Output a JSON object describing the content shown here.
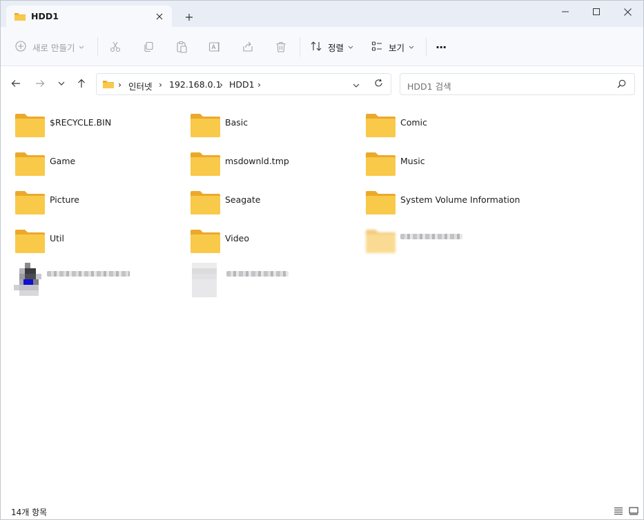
{
  "tab": {
    "title": "HDD1",
    "close_icon": "close-icon",
    "new_tab_icon": "plus-icon"
  },
  "window_controls": {
    "minimize": "minimize-icon",
    "maximize": "maximize-icon",
    "close": "close-icon"
  },
  "toolbar": {
    "new_label": "새로 만들기",
    "sort_label": "정렬",
    "view_label": "보기",
    "more_label": "···"
  },
  "address": {
    "crumbs": [
      "인터넷",
      "192.168.0.1",
      "HDD1"
    ]
  },
  "search": {
    "placeholder": "HDD1 검색"
  },
  "items": [
    {
      "name": "$RECYCLE.BIN"
    },
    {
      "name": "Basic"
    },
    {
      "name": "Comic"
    },
    {
      "name": "Game"
    },
    {
      "name": "msdownld.tmp"
    },
    {
      "name": "Music"
    },
    {
      "name": "Picture"
    },
    {
      "name": "Seagate"
    },
    {
      "name": "System Volume Information"
    },
    {
      "name": "Util"
    },
    {
      "name": "Video"
    }
  ],
  "status": {
    "count": "14개 항목"
  },
  "colors": {
    "folder_front": "#f9c94a",
    "folder_back": "#eba92b",
    "accent": "#0067c0"
  }
}
